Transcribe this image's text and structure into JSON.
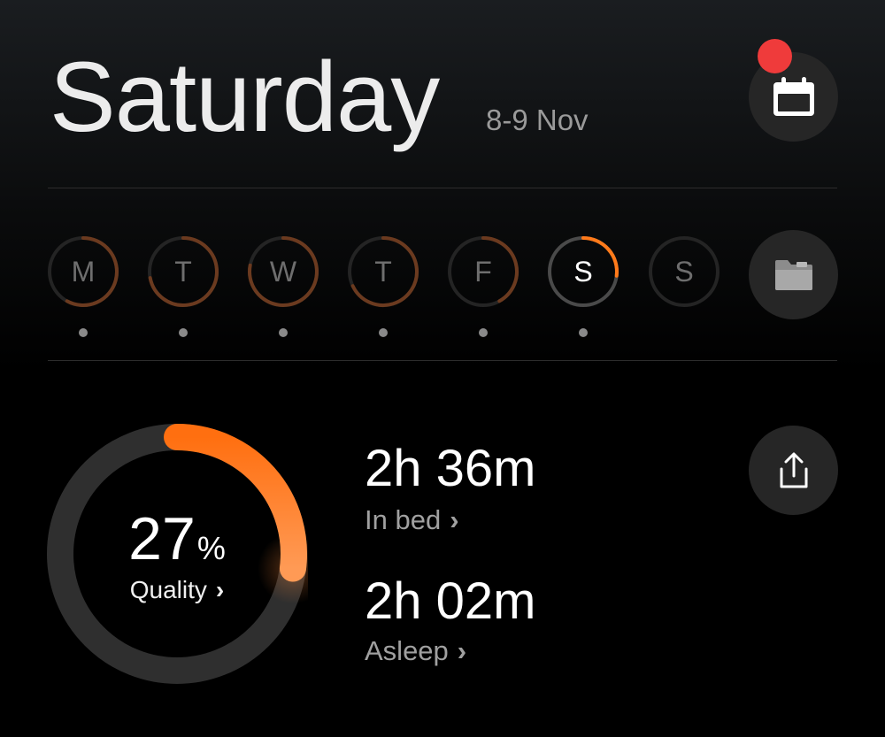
{
  "header": {
    "title": "Saturday",
    "date_range": "8-9 Nov",
    "calendar_icon": "calendar-icon",
    "has_notification": true
  },
  "week": {
    "days": [
      {
        "letter": "M",
        "progress": 0.58,
        "has_record": true,
        "active": false
      },
      {
        "letter": "T",
        "progress": 0.72,
        "has_record": true,
        "active": false
      },
      {
        "letter": "W",
        "progress": 0.78,
        "has_record": true,
        "active": false
      },
      {
        "letter": "T",
        "progress": 0.68,
        "has_record": true,
        "active": false
      },
      {
        "letter": "F",
        "progress": 0.42,
        "has_record": true,
        "active": false
      },
      {
        "letter": "S",
        "progress": 0.27,
        "has_record": true,
        "active": true
      },
      {
        "letter": "S",
        "progress": 0,
        "has_record": false,
        "active": false
      }
    ],
    "folder_icon": "folder-icon"
  },
  "summary": {
    "quality_value": "27",
    "quality_symbol": "%",
    "quality_fraction": 0.27,
    "quality_label": "Quality",
    "in_bed_value": "2h 36m",
    "in_bed_label": "In bed",
    "asleep_value": "2h 02m",
    "asleep_label": "Asleep",
    "share_icon": "share-icon"
  },
  "colors": {
    "accent": "#ff7a1a",
    "accent_light": "#ff9b4f",
    "track": "#2f2f2f",
    "notification": "#ef3b3b"
  }
}
